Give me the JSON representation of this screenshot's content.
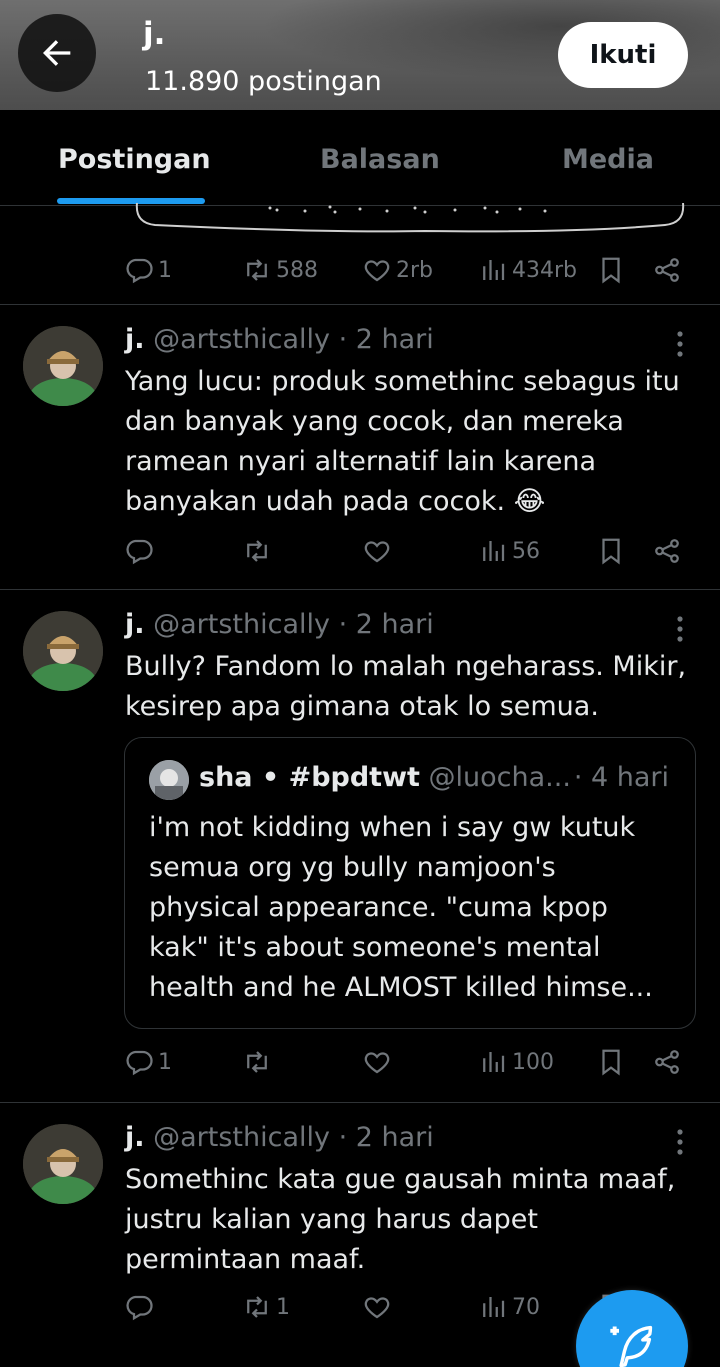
{
  "header": {
    "name": "j.",
    "post_count": "11.890 postingan",
    "follow_label": "Ikuti"
  },
  "tabs": [
    {
      "label": "Postingan",
      "active": true
    },
    {
      "label": "Balasan",
      "active": false
    },
    {
      "label": "Media",
      "active": false
    }
  ],
  "partial_post": {
    "replies": "1",
    "reposts": "588",
    "likes": "2rb",
    "views": "434rb"
  },
  "posts": [
    {
      "name": "j.",
      "handle": "@artsthically",
      "time": "· 2 hari",
      "text": "Yang lucu: produk somethinc sebagus itu\ndan banyak yang cocok, dan mereka\nramean nyari alternatif lain karena\nbanyakan udah pada cocok. 😂",
      "replies": "",
      "reposts": "",
      "likes": "",
      "views": "56"
    },
    {
      "name": "j.",
      "handle": "@artsthically",
      "time": "· 2 hari",
      "text": "Bully? Fandom lo malah ngeharass. Mikir,\nkesirep apa gimana otak lo semua.",
      "quote": {
        "name": "sha • #bpdtwt",
        "handle": "@luocha...",
        "time": "· 4 hari",
        "text": "i'm not kidding when i say gw kutuk\nsemua org yg bully namjoon's\nphysical appearance. \"cuma kpop\nkak\" it's about someone's mental\nhealth and he ALMOST killed himse..."
      },
      "replies": "1",
      "reposts": "",
      "likes": "",
      "views": "100"
    },
    {
      "name": "j.",
      "handle": "@artsthically",
      "time": "· 2 hari",
      "text": "Somethinc kata gue gausah minta maaf,\njustru kalian yang harus dapet\npermintaan maaf.",
      "replies": "",
      "reposts": "1",
      "likes": "",
      "views": "70"
    }
  ],
  "colors": {
    "accent": "#1d9bf0",
    "muted": "#71767b",
    "divider": "#2f3336",
    "text": "#e7e9ea"
  }
}
